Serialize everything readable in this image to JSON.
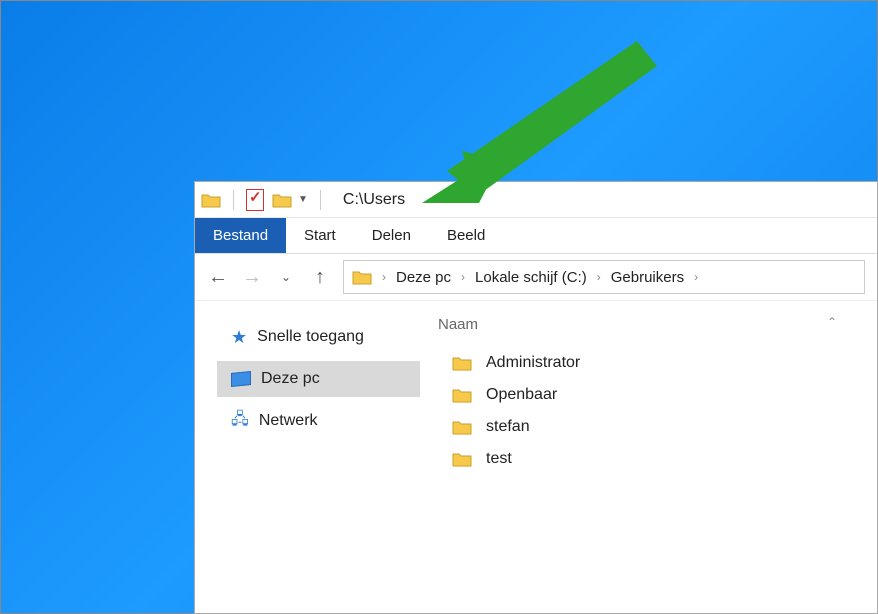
{
  "titlebar": {
    "path": "C:\\Users"
  },
  "ribbon": {
    "file": "Bestand",
    "home": "Start",
    "share": "Delen",
    "view": "Beeld"
  },
  "breadcrumb": {
    "crumb1": "Deze pc",
    "crumb2": "Lokale schijf (C:)",
    "crumb3": "Gebruikers"
  },
  "tree": {
    "quick_access": "Snelle toegang",
    "this_pc": "Deze pc",
    "network": "Netwerk"
  },
  "columns": {
    "name": "Naam"
  },
  "files": {
    "f0": "Administrator",
    "f1": "Openbaar",
    "f2": "stefan",
    "f3": "test"
  }
}
